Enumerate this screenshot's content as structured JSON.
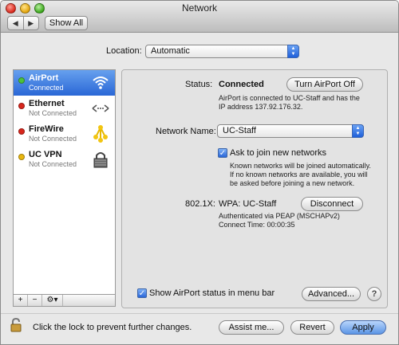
{
  "window": {
    "title": "Network"
  },
  "toolbar": {
    "back_glyph": "◀",
    "forward_glyph": "▶",
    "show_all_label": "Show All"
  },
  "location": {
    "label": "Location:",
    "value": "Automatic"
  },
  "services": [
    {
      "name": "AirPort",
      "status": "Connected",
      "indicator_color": "#4cc23b",
      "icon": "wifi-icon",
      "selected": true
    },
    {
      "name": "Ethernet",
      "status": "Not Connected",
      "indicator_color": "#d8261c",
      "icon": "ethernet-icon",
      "selected": false
    },
    {
      "name": "FireWire",
      "status": "Not Connected",
      "indicator_color": "#d8261c",
      "icon": "firewire-icon",
      "selected": false
    },
    {
      "name": "UC VPN",
      "status": "Not Connected",
      "indicator_color": "#e9b70f",
      "icon": "vpn-lock-icon",
      "selected": false
    }
  ],
  "sidebar_tools": {
    "add": "+",
    "remove": "−",
    "action": "⚙▾"
  },
  "detail": {
    "status_label": "Status:",
    "status_value": "Connected",
    "toggle_button": "Turn AirPort Off",
    "status_line1": "AirPort is connected to UC-Staff and has the",
    "status_line2": "IP address 137.92.176.32.",
    "network_name_label": "Network Name:",
    "network_name_value": "UC-Staff",
    "ask_label": "Ask to join new networks",
    "ask_line1": "Known networks will be joined automatically.",
    "ask_line2": "If no known networks are available, you will",
    "ask_line3": "be asked before joining a new network.",
    "dot1x_label": "802.1X:",
    "dot1x_value": "WPA: UC-Staff",
    "disconnect_button": "Disconnect",
    "auth_line": "Authenticated via PEAP (MSCHAPv2)",
    "connect_time": "Connect Time: 00:00:35",
    "show_status_label": "Show AirPort status in menu bar",
    "advanced_button": "Advanced...",
    "help_glyph": "?"
  },
  "footer": {
    "lock_text": "Click the lock to prevent further changes.",
    "assist_button": "Assist me...",
    "revert_button": "Revert",
    "apply_button": "Apply"
  },
  "colors": {
    "selection": "#2a67d6",
    "accent": "#1f5fd9"
  }
}
